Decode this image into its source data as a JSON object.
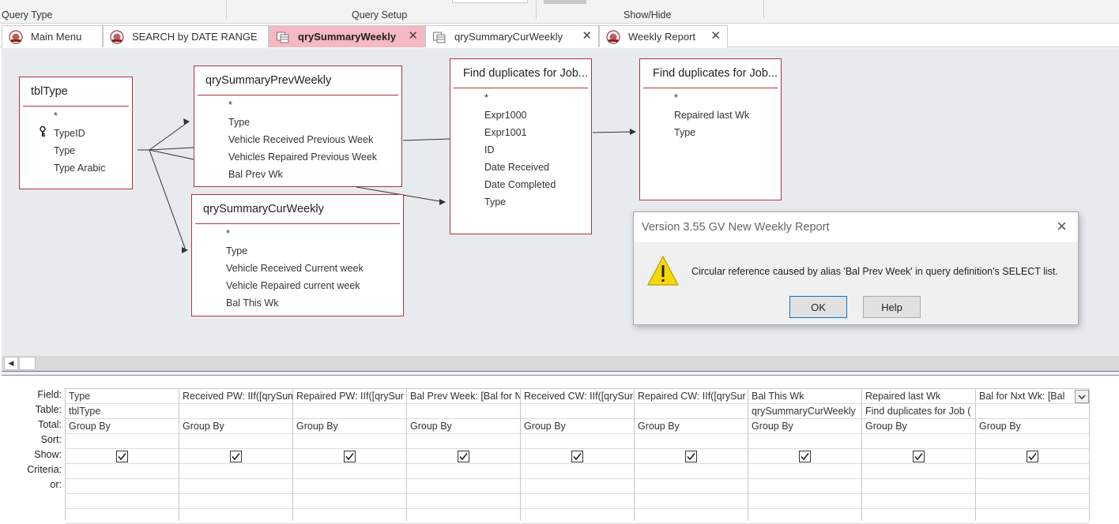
{
  "ribbon": {
    "groups": [
      "Query Type",
      "Query Setup",
      "Show/Hide"
    ]
  },
  "tabs": [
    {
      "label": "Main Menu",
      "icon": "form-icon",
      "closable": false,
      "active": false
    },
    {
      "label": "SEARCH by DATE RANGE",
      "icon": "form-icon",
      "closable": false,
      "active": false
    },
    {
      "label": "qrySummaryWeekly",
      "icon": "query-icon",
      "closable": true,
      "active": true
    },
    {
      "label": "qrySummaryCurWeekly",
      "icon": "query-icon",
      "closable": true,
      "active": false
    },
    {
      "label": "Weekly Report",
      "icon": "report-icon",
      "closable": true,
      "active": false
    }
  ],
  "field_lists": [
    {
      "title": "tblType",
      "fields": [
        "*",
        "TypeID",
        "Type",
        "Type Arabic"
      ],
      "key_field": "TypeID"
    },
    {
      "title": "qrySummaryPrevWeekly",
      "fields": [
        "*",
        "Type",
        "Vehicle Received Previous Week",
        "Vehicles Repaired Previous Week",
        "Bal Prev Wk"
      ]
    },
    {
      "title": "qrySummaryCurWeekly",
      "fields": [
        "*",
        "Type",
        "Vehicle Received Current week",
        "Vehicle Repaired current week",
        "Bal This Wk"
      ]
    },
    {
      "title": "Find duplicates for Job...",
      "fields": [
        "*",
        "Expr1000",
        "Expr1001",
        "ID",
        "Date Received",
        "Date Completed",
        "Type"
      ]
    },
    {
      "title": "Find duplicates for Job...",
      "fields": [
        "*",
        "Repaired last Wk",
        "Type"
      ]
    }
  ],
  "dialog": {
    "title": "Version 3.55 GV New Weekly Report",
    "message": "Circular reference caused by alias 'Bal Prev Week' in query definition's SELECT list.",
    "ok_label": "OK",
    "help_label": "Help",
    "icon": "warning-icon"
  },
  "grid": {
    "row_labels": [
      "Field:",
      "Table:",
      "Total:",
      "Sort:",
      "Show:",
      "Criteria:",
      "or:"
    ],
    "columns": [
      {
        "field": "Type",
        "table": "tblType",
        "total": "Group By",
        "show": true
      },
      {
        "field": "Received PW: IIf([qrySum",
        "table": "",
        "total": "Group By",
        "show": true
      },
      {
        "field": "Repaired PW: IIf([qrySur",
        "table": "",
        "total": "Group By",
        "show": true
      },
      {
        "field": "Bal Prev Week: [Bal for N",
        "table": "",
        "total": "Group By",
        "show": true
      },
      {
        "field": "Received CW: IIf([qrySur",
        "table": "",
        "total": "Group By",
        "show": true
      },
      {
        "field": "Repaired CW: IIf([qrySur",
        "table": "",
        "total": "Group By",
        "show": true
      },
      {
        "field": "Bal This Wk",
        "table": "qrySummaryCurWeekly",
        "total": "Group By",
        "show": true
      },
      {
        "field": "Repaired last Wk",
        "table": "Find duplicates for Job (",
        "total": "Group By",
        "show": true
      },
      {
        "field": "Bal for Nxt Wk: [Bal",
        "table": "",
        "total": "Group By",
        "show": true
      }
    ]
  },
  "colors": {
    "active_tab": "#f6b8c3",
    "field_list_border": "#b0323e",
    "canvas_bg": "#e8ebee"
  }
}
